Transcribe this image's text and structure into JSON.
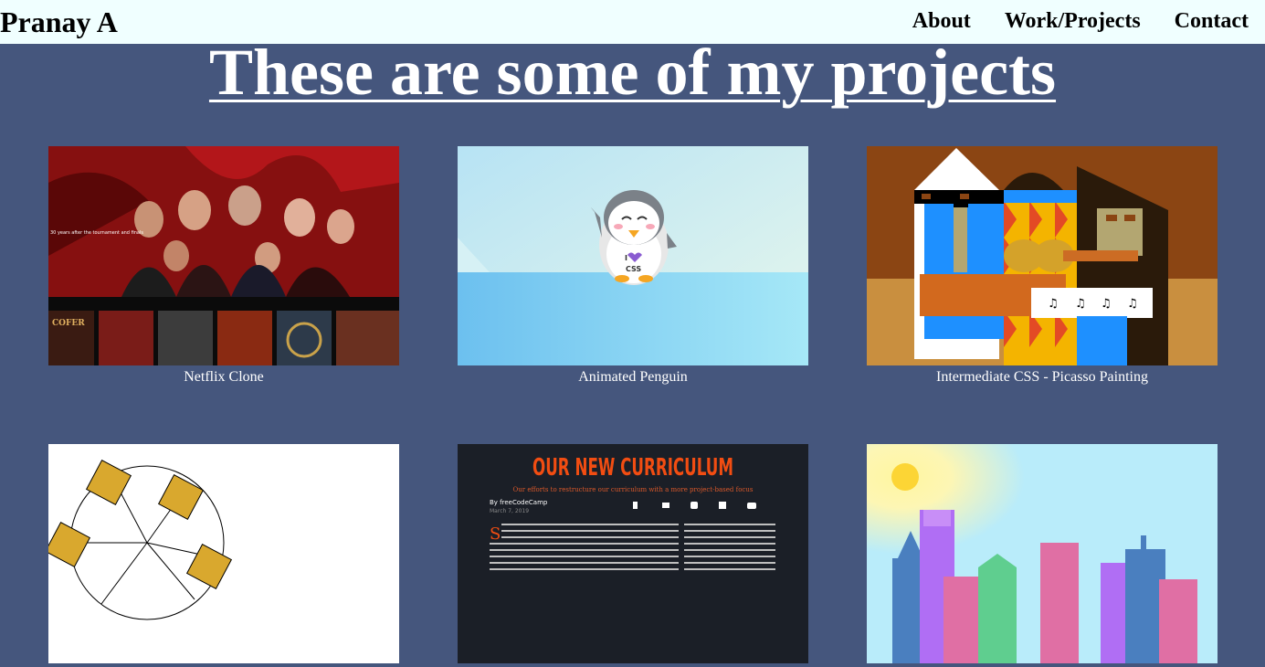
{
  "navbar": {
    "brand": "Pranay A",
    "links": [
      "About",
      "Work/Projects",
      "Contact"
    ]
  },
  "heading": "These are some of my projects",
  "projects": [
    {
      "title": "Netflix Clone"
    },
    {
      "title": "Animated Penguin"
    },
    {
      "title": "Intermediate CSS - Picasso Painting"
    },
    {
      "title": ""
    },
    {
      "title": ""
    },
    {
      "title": ""
    }
  ],
  "thumb_text": {
    "netflix_tag": "30 years after the tournament and finals",
    "netflix_row_label": "COFER",
    "penguin_label": "CSS",
    "penguin_prefix": "I",
    "curriculum_title": "OUR NEW CURRICULUM",
    "curriculum_subtitle": "Our efforts to restructure our curriculum with a more project-based focus",
    "curriculum_author": "By freeCodeCamp",
    "curriculum_date": "March 7, 2019"
  },
  "colors": {
    "background": "#45567d",
    "navbar": "#f0ffff",
    "heading": "#ffffff"
  }
}
